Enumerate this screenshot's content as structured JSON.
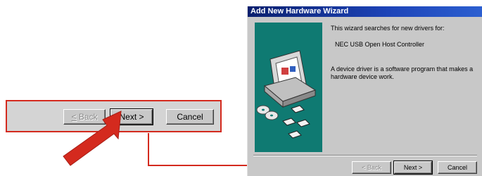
{
  "callout": {
    "back_label": "< Back",
    "next_label": "Next >",
    "cancel_label": "Cancel"
  },
  "wizard": {
    "title": "Add New Hardware Wizard",
    "intro": "This wizard searches for new drivers for:",
    "device": "NEC USB Open Host Controller",
    "description_line1": "A device driver is a software program that makes a",
    "description_line2": "hardware device work.",
    "back_label": "< Back",
    "next_label": "Next >",
    "cancel_label": "Cancel"
  },
  "colors": {
    "annotation": "#d42a1e",
    "title_bar": "#0a1f6e",
    "illustration_bg": "#0f7a72",
    "button_face": "#c8c8c8"
  },
  "icons": [
    "computer-icon",
    "cd-disc-icon",
    "floppy-disk-icon",
    "pointer-arrow-icon"
  ]
}
